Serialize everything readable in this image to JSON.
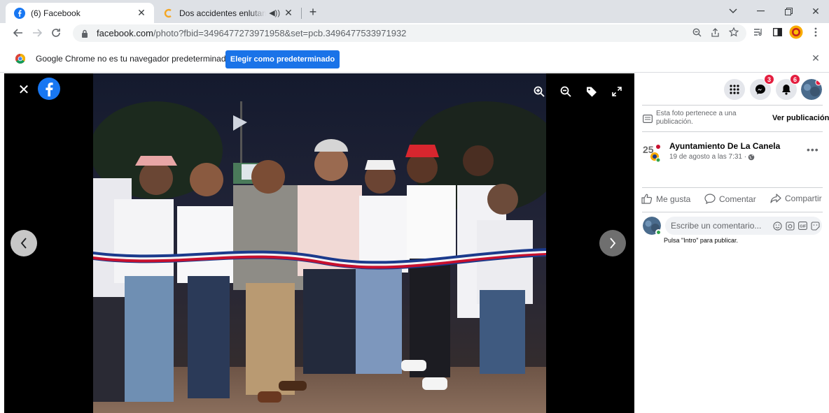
{
  "browser": {
    "tabs": [
      {
        "title": "(6) Facebook",
        "active": true
      },
      {
        "title": "Dos accidentes enlutan la co",
        "active": false
      }
    ],
    "url_host": "facebook.com",
    "url_path": "/photo?fbid=3496477273971958&set=pcb.3496477533971932"
  },
  "infobar": {
    "message": "Google Chrome no es tu navegador predeterminado",
    "button_label": "Elegir como predeterminado"
  },
  "panel": {
    "notifications": {
      "messenger_count": "3",
      "bell_count": "6"
    },
    "belongs_text": "Esta foto pertenece a una publicación.",
    "view_post_label": "Ver publicación",
    "page_name": "Ayuntamiento De La Canela",
    "post_date": "19 de agosto a las 7:31 ·",
    "actions": {
      "like": "Me gusta",
      "comment": "Comentar",
      "share": "Compartir"
    },
    "comment_placeholder": "Escribe un comentario...",
    "enter_hint": "Pulsa \"Intro\" para publicar."
  },
  "colors": {
    "facebook_blue": "#1877f2",
    "chrome_blue": "#1a73e8",
    "badge_red": "#e41e3f"
  },
  "icons": [
    "facebook-logo-icon",
    "close-icon",
    "zoom-in-icon",
    "zoom-out-icon",
    "tag-icon",
    "fullscreen-icon",
    "chevron-left-icon",
    "chevron-right-icon",
    "menu-grid-icon",
    "messenger-icon",
    "bell-icon",
    "like-icon",
    "comment-icon",
    "share-icon",
    "globe-icon",
    "more-icon"
  ]
}
